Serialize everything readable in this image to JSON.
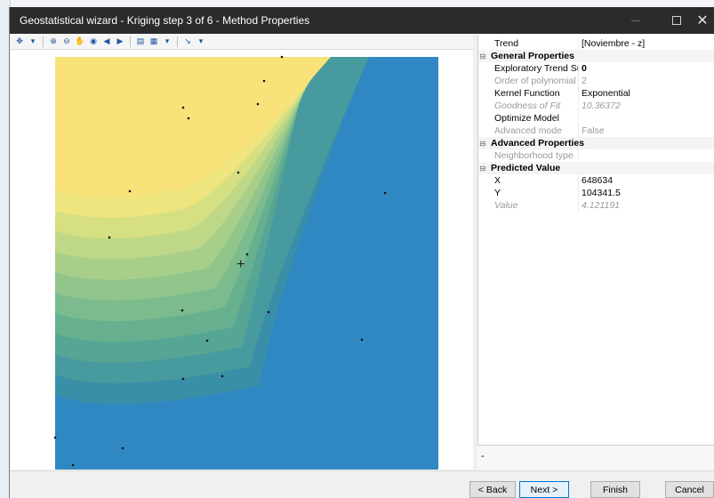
{
  "window": {
    "title": "Geostatistical wizard - Kriging step 3 of 6 - Method Properties",
    "close_glyph": "✕"
  },
  "toolbar": {
    "icons": [
      "select-tool-icon",
      "dropdown-icon",
      "zoom-in-icon",
      "zoom-out-icon",
      "pan-icon",
      "full-extent-icon",
      "back-icon",
      "forward-icon",
      "layers-icon",
      "legend-icon",
      "dropdown-icon",
      "symbology-icon",
      "dropdown-icon"
    ]
  },
  "map": {
    "cursor_glyph": "+",
    "contour_colors": [
      "#f9e27a",
      "#eee57e",
      "#d7df83",
      "#bfd887",
      "#a8cf8a",
      "#91c58b",
      "#7bbb8d",
      "#66b08f",
      "#56a595",
      "#479a9e",
      "#3a8fa8",
      "#2f88c2"
    ],
    "background_color": "#2f88c2"
  },
  "properties": {
    "rows": [
      {
        "type": "prop",
        "name": "Trend",
        "value": "[Noviembre - z]",
        "state": "normal"
      },
      {
        "type": "category",
        "name": "General Properties"
      },
      {
        "type": "prop",
        "name": "Exploratory Trend Sur...",
        "value": "0",
        "state": "bold"
      },
      {
        "type": "prop",
        "name": "Order of polynomial",
        "value": "2",
        "state": "disabled"
      },
      {
        "type": "prop",
        "name": "Kernel Function",
        "value": "Exponential",
        "state": "normal"
      },
      {
        "type": "prop",
        "name": "Goodness of Fit",
        "value": "10.36372",
        "state": "disabled-italic"
      },
      {
        "type": "prop",
        "name": "Optimize Model",
        "value": "",
        "state": "normal"
      },
      {
        "type": "prop",
        "name": "Advanced mode",
        "value": "False",
        "state": "disabled"
      },
      {
        "type": "category",
        "name": "Advanced Properties"
      },
      {
        "type": "prop",
        "name": "Neighborhood type",
        "value": "",
        "state": "disabled"
      },
      {
        "type": "category",
        "name": "Predicted Value"
      },
      {
        "type": "prop",
        "name": "X",
        "value": "648634",
        "state": "normal"
      },
      {
        "type": "prop",
        "name": "Y",
        "value": "104341.5",
        "state": "normal"
      },
      {
        "type": "prop",
        "name": "Value",
        "value": "4.121191",
        "state": "disabled-italic"
      }
    ]
  },
  "description": "-",
  "buttons": {
    "back": "< Back",
    "next": "Next >",
    "finish": "Finish",
    "cancel": "Cancel"
  }
}
